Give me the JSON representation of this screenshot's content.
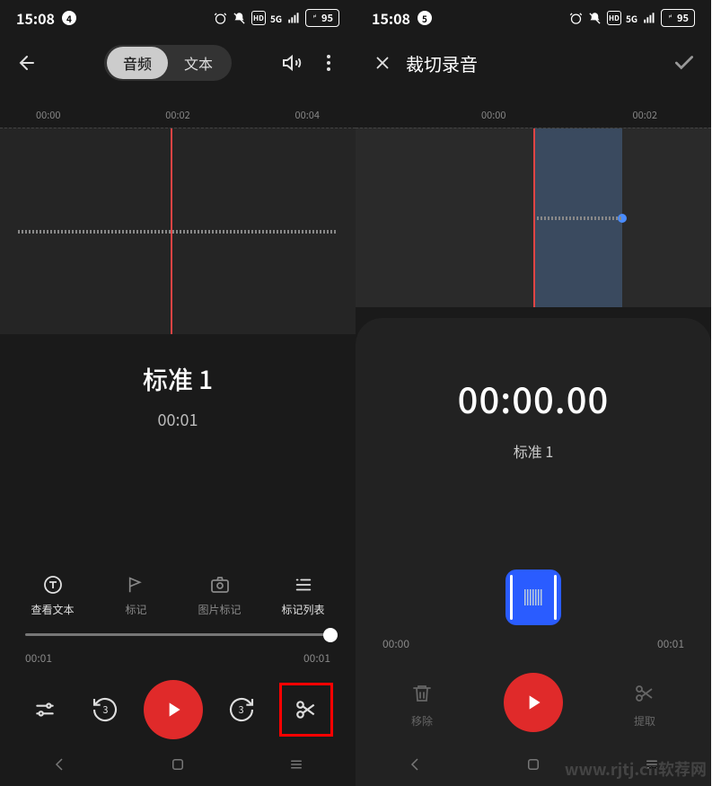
{
  "status": {
    "time": "15:08",
    "left_badge_a": "4",
    "left_badge_b": "5",
    "signal": "5G",
    "hd": "HD",
    "battery": "95"
  },
  "left": {
    "seg_audio": "音频",
    "seg_text": "文本",
    "timeline": {
      "t0": "00:00",
      "t1": "00:02",
      "t2": "00:04"
    },
    "title": "标准 1",
    "current_time": "00:01",
    "markers": {
      "view_text": "查看文本",
      "mark": "标记",
      "photo_mark": "图片标记",
      "mark_list": "标记列表"
    },
    "slider": {
      "start": "00:01",
      "end": "00:01"
    },
    "rewind": "3",
    "forward": "3"
  },
  "right": {
    "header_title": "裁切录音",
    "timeline": {
      "t0": "00:00",
      "t1": "00:02"
    },
    "bigtime": "00:00.00",
    "subtitle": "标准 1",
    "times": {
      "start": "00:00",
      "end": "00:01"
    },
    "remove": "移除",
    "extract": "提取"
  },
  "watermark": "www.rjtj.cn软荐网"
}
